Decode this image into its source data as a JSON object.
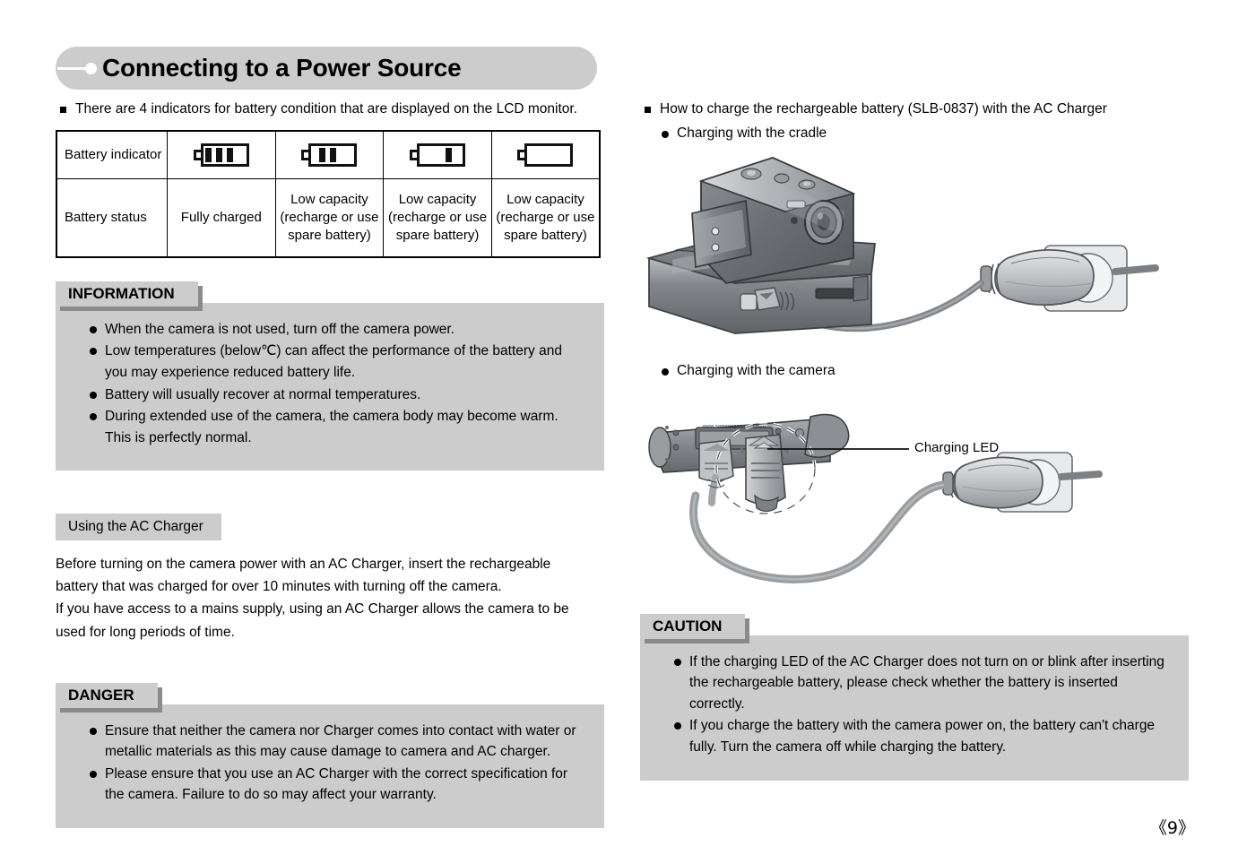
{
  "header": {
    "title": "Connecting to a Power Source"
  },
  "left_column": {
    "intro_bullet": "There are 4 indicators for battery condition that are displayed on the LCD monitor.",
    "battery_table": {
      "row_labels": [
        "Battery indicator",
        "Battery status"
      ],
      "indicators": [
        {
          "icon": "battery-full-icon",
          "bars": 3
        },
        {
          "icon": "battery-two-bars-icon",
          "bars": 2
        },
        {
          "icon": "battery-one-bar-icon",
          "bars": 1
        },
        {
          "icon": "battery-empty-icon",
          "bars": 0
        }
      ],
      "statuses": [
        "Fully charged",
        "Low capacity\n(recharge or use\nspare battery)",
        "Low capacity\n(recharge or use\nspare battery)",
        "Low capacity\n(recharge or use\nspare battery)"
      ]
    },
    "information_box": {
      "tag": "INFORMATION",
      "items": [
        "When the camera is not used, turn off the camera power.",
        "Low temperatures (below℃) can affect the performance of the battery and you may experience reduced battery life.",
        "Battery will usually recover at normal temperatures.",
        "During extended use of the camera, the camera body may become warm. This is perfectly normal."
      ]
    },
    "ac_charger_section": {
      "heading": "Using the AC Charger",
      "paragraph": "Before turning on the camera power with an AC Charger, insert the rechargeable battery that was charged for over 10 minutes with turning off the camera.\nIf you have access to a mains supply, using an AC Charger allows the camera to be used for long periods of time."
    },
    "danger_box": {
      "tag": "DANGER",
      "items": [
        "Ensure that neither the camera nor Charger comes into contact with water or metallic materials as this may cause damage to camera and AC charger.",
        "Please ensure that you use an AC Charger with the correct specification for the camera. Failure to do so may affect your warranty."
      ]
    }
  },
  "right_column": {
    "intro_bullet": "How to charge the rechargeable battery (SLB-0837) with the AC Charger",
    "sub_bullet_cradle": "Charging with the cradle",
    "sub_bullet_camera": "Charging with the camera",
    "cradle_illustration": {
      "name": "camera-in-cradle-with-ac-adapter-illustration"
    },
    "camera_illustration": {
      "name": "camera-with-ac-adapter-illustration",
      "annotation": "Charging LED"
    },
    "caution_box": {
      "tag": "CAUTION",
      "items": [
        "If the charging LED of the AC Charger does not turn on or blink after inserting the rechargeable battery, please check whether the battery is inserted correctly.",
        "If you charge the battery with the camera power on, the battery can't charge fully. Turn the camera off while charging the battery."
      ]
    }
  },
  "footer": {
    "page_number": "《9》"
  },
  "colors": {
    "panel_gray": "#cccccc",
    "tag_shadow": "#8a8a8a",
    "text": "#000000",
    "background": "#ffffff"
  }
}
